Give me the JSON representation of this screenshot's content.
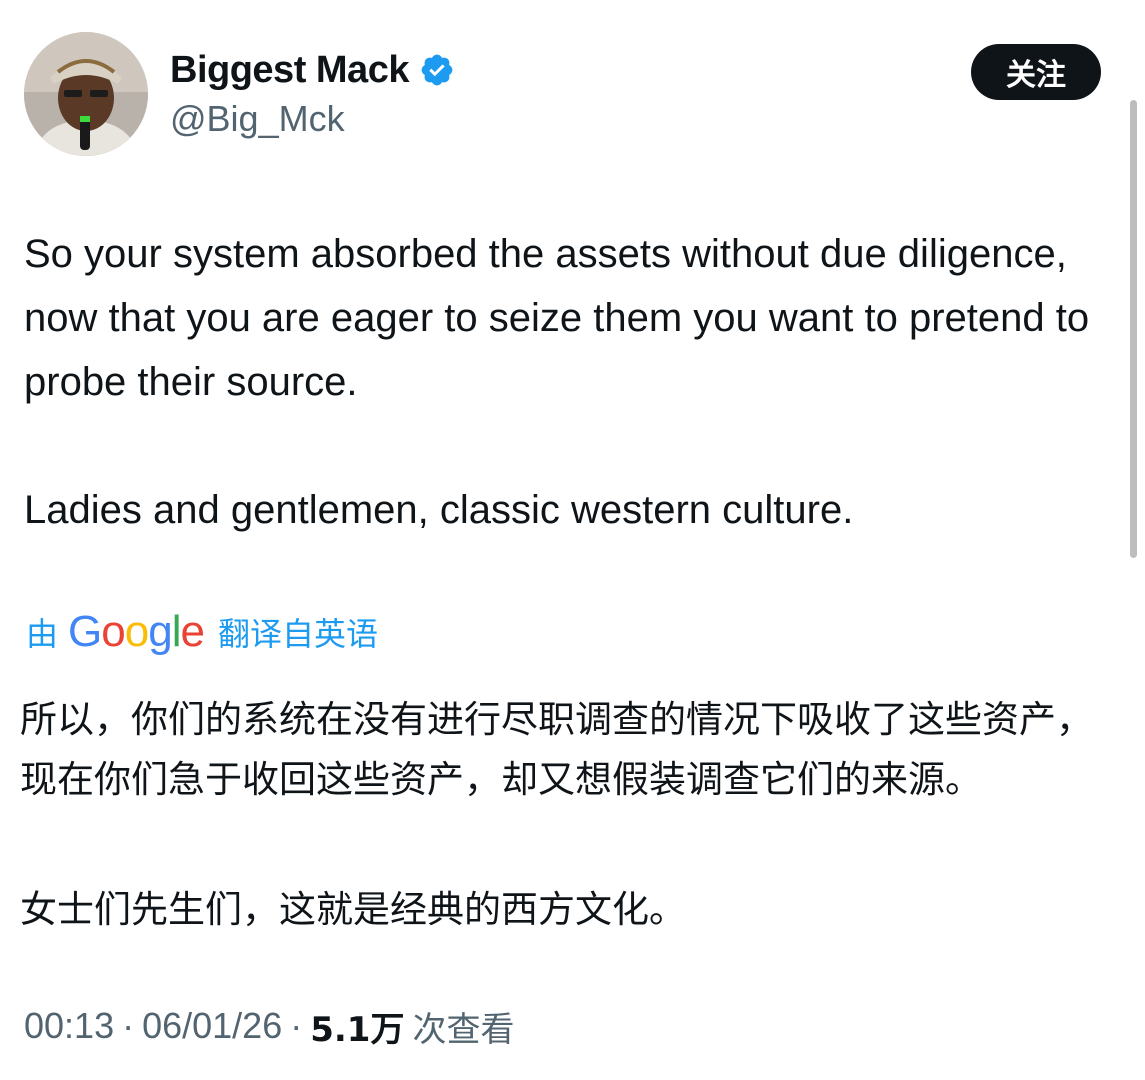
{
  "author": {
    "display_name": "Biggest Mack",
    "handle": "@Big_Mck",
    "verified": true
  },
  "follow_button": {
    "label": "关注"
  },
  "tweet": {
    "paragraphs_en": [
      "So your system absorbed the assets without due diligence, now that you are eager to seize them you want to pretend to probe their source.",
      "Ladies and gentlemen, classic western culture."
    ],
    "translation": {
      "prefix": "由",
      "provider": "Google",
      "suffix": "翻译自英语"
    },
    "paragraphs_zh": [
      "所以，你们的系统在没有进行尽职调查的情况下吸收了这些资产，现在你们急于收回这些资产，却又想假装调查它们的来源。",
      "女士们先生们，这就是经典的西方文化。"
    ]
  },
  "meta": {
    "time": "00:13",
    "date": "06/01/26",
    "views_count": "5.1万",
    "views_label": "次查看"
  },
  "colors": {
    "text_primary": "#0f1419",
    "text_secondary": "#536471",
    "accent": "#1d9bf0",
    "button_bg": "#0f1419"
  }
}
